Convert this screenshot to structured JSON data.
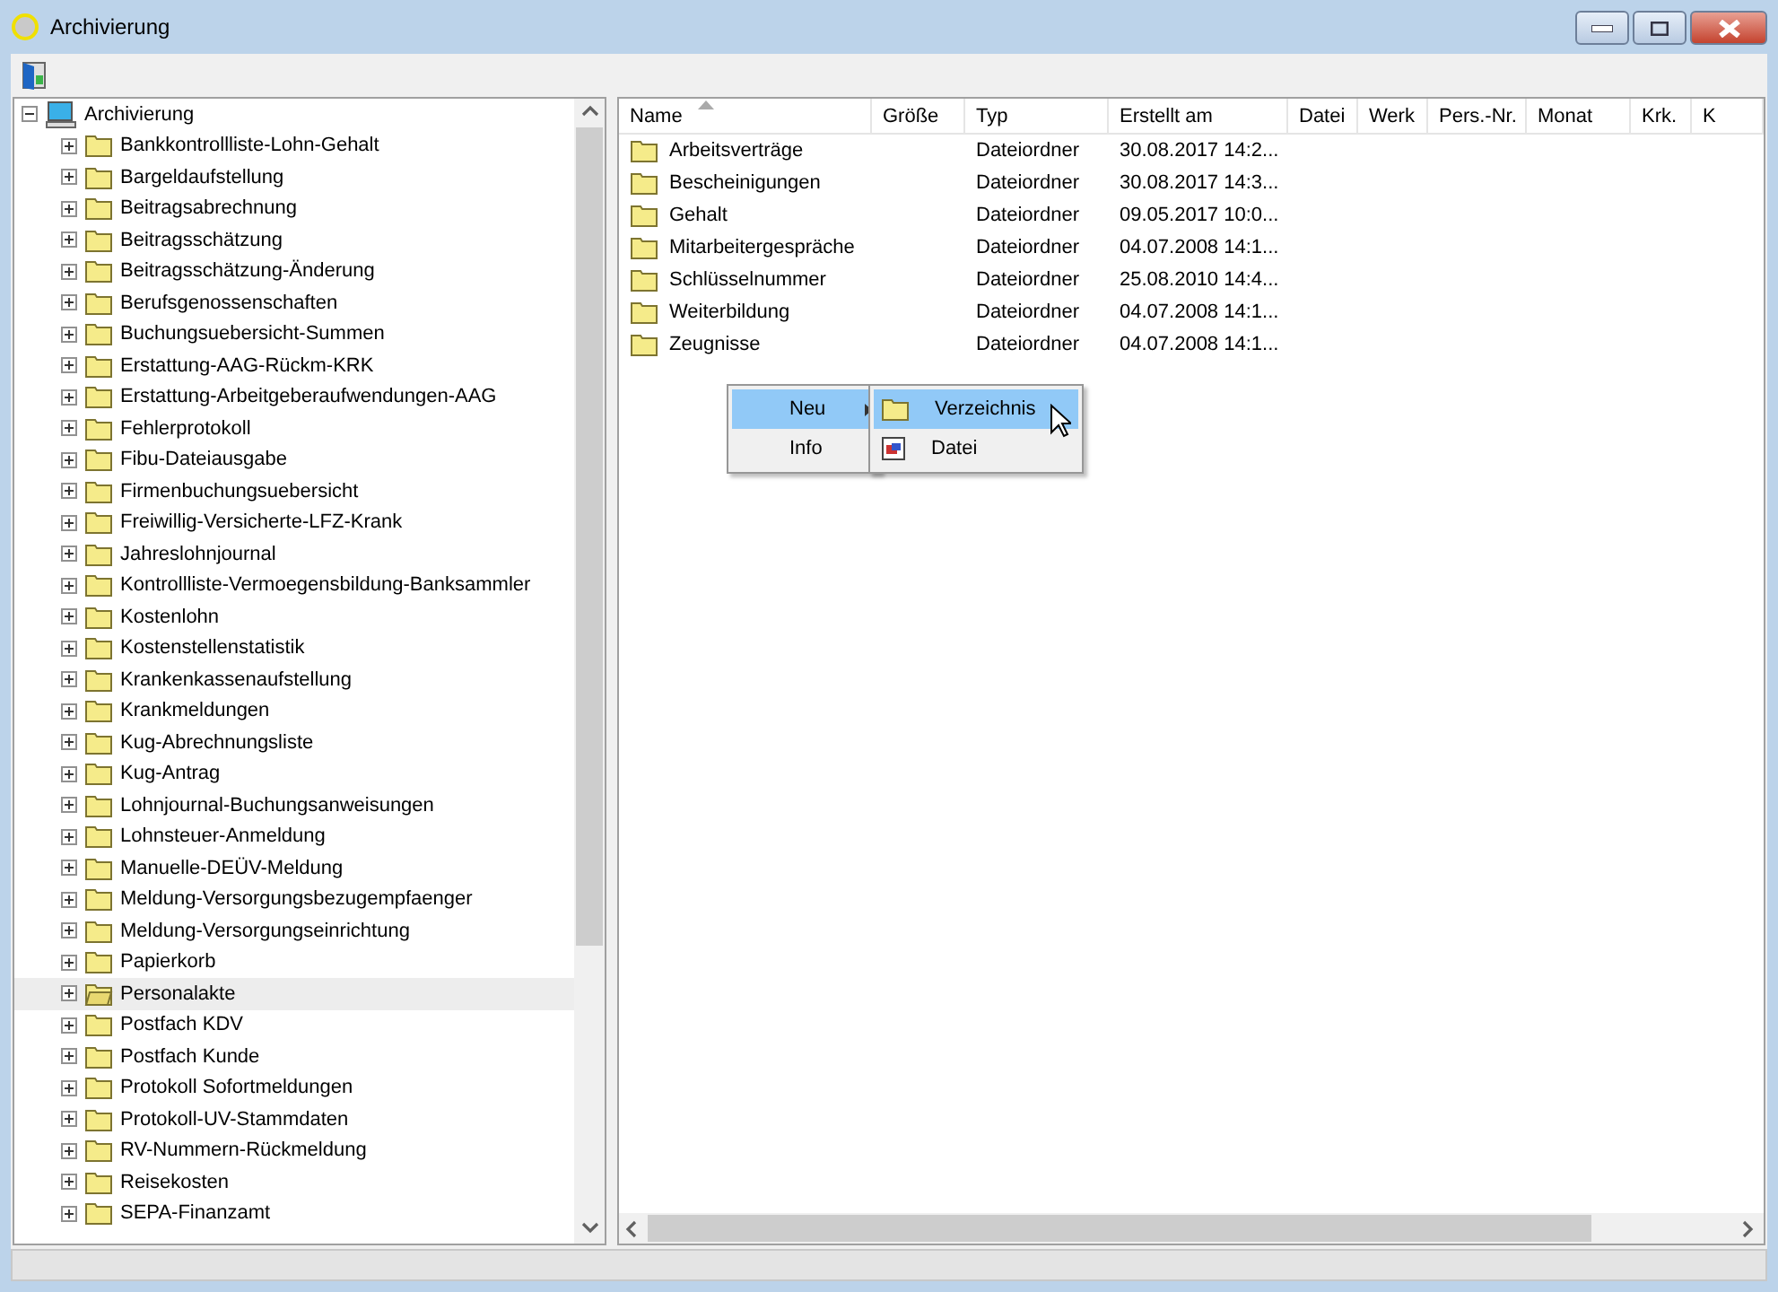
{
  "window": {
    "title": "Archivierung"
  },
  "tree": {
    "label": "Archivierung",
    "expanded": true,
    "children": [
      {
        "label": "Bankkontrollliste-Lohn-Gehalt",
        "expanded": false,
        "selected": false
      },
      {
        "label": "Bargeldaufstellung",
        "expanded": false,
        "selected": false
      },
      {
        "label": "Beitragsabrechnung",
        "expanded": false,
        "selected": false
      },
      {
        "label": "Beitragsschätzung",
        "expanded": false,
        "selected": false
      },
      {
        "label": "Beitragsschätzung-Änderung",
        "expanded": false,
        "selected": false
      },
      {
        "label": "Berufsgenossenschaften",
        "expanded": false,
        "selected": false
      },
      {
        "label": "Buchungsuebersicht-Summen",
        "expanded": false,
        "selected": false
      },
      {
        "label": "Erstattung-AAG-Rückm-KRK",
        "expanded": false,
        "selected": false
      },
      {
        "label": "Erstattung-Arbeitgeberaufwendungen-AAG",
        "expanded": false,
        "selected": false
      },
      {
        "label": "Fehlerprotokoll",
        "expanded": false,
        "selected": false
      },
      {
        "label": "Fibu-Dateiausgabe",
        "expanded": false,
        "selected": false
      },
      {
        "label": "Firmenbuchungsuebersicht",
        "expanded": false,
        "selected": false
      },
      {
        "label": "Freiwillig-Versicherte-LFZ-Krank",
        "expanded": false,
        "selected": false
      },
      {
        "label": "Jahreslohnjournal",
        "expanded": false,
        "selected": false
      },
      {
        "label": "Kontrollliste-Vermoegensbildung-Banksammler",
        "expanded": false,
        "selected": false
      },
      {
        "label": "Kostenlohn",
        "expanded": false,
        "selected": false
      },
      {
        "label": "Kostenstellenstatistik",
        "expanded": false,
        "selected": false
      },
      {
        "label": "Krankenkassenaufstellung",
        "expanded": false,
        "selected": false
      },
      {
        "label": "Krankmeldungen",
        "expanded": false,
        "selected": false
      },
      {
        "label": "Kug-Abrechnungsliste",
        "expanded": false,
        "selected": false
      },
      {
        "label": "Kug-Antrag",
        "expanded": false,
        "selected": false
      },
      {
        "label": "Lohnjournal-Buchungsanweisungen",
        "expanded": false,
        "selected": false
      },
      {
        "label": "Lohnsteuer-Anmeldung",
        "expanded": false,
        "selected": false
      },
      {
        "label": "Manuelle-DEÜV-Meldung",
        "expanded": false,
        "selected": false
      },
      {
        "label": "Meldung-Versorgungsbezugempfaenger",
        "expanded": false,
        "selected": false
      },
      {
        "label": "Meldung-Versorgungseinrichtung",
        "expanded": false,
        "selected": false
      },
      {
        "label": "Papierkorb",
        "expanded": false,
        "selected": false
      },
      {
        "label": "Personalakte",
        "expanded": false,
        "selected": true
      },
      {
        "label": "Postfach KDV",
        "expanded": false,
        "selected": false
      },
      {
        "label": "Postfach Kunde",
        "expanded": false,
        "selected": false
      },
      {
        "label": "Protokoll Sofortmeldungen",
        "expanded": false,
        "selected": false
      },
      {
        "label": "Protokoll-UV-Stammdaten",
        "expanded": false,
        "selected": false
      },
      {
        "label": "RV-Nummern-Rückmeldung",
        "expanded": false,
        "selected": false
      },
      {
        "label": "Reisekosten",
        "expanded": false,
        "selected": false
      },
      {
        "label": "SEPA-Finanzamt",
        "expanded": false,
        "selected": false
      }
    ]
  },
  "list": {
    "columns": [
      {
        "label": "Name",
        "sorted": true
      },
      {
        "label": "Größe",
        "sorted": false
      },
      {
        "label": "Typ",
        "sorted": false
      },
      {
        "label": "Erstellt am",
        "sorted": false
      },
      {
        "label": "Datei",
        "sorted": false
      },
      {
        "label": "Werk",
        "sorted": false
      },
      {
        "label": "Pers.-Nr.",
        "sorted": false
      },
      {
        "label": "Monat",
        "sorted": false
      },
      {
        "label": "Krk.",
        "sorted": false
      },
      {
        "label": "K",
        "sorted": false
      }
    ],
    "rows": [
      {
        "name": "Arbeitsverträge",
        "type": "Dateiordner",
        "created": "30.08.2017 14:2..."
      },
      {
        "name": "Bescheinigungen",
        "type": "Dateiordner",
        "created": "30.08.2017 14:3..."
      },
      {
        "name": "Gehalt",
        "type": "Dateiordner",
        "created": "09.05.2017 10:0..."
      },
      {
        "name": "Mitarbeitergespräche",
        "type": "Dateiordner",
        "created": "04.07.2008 14:1..."
      },
      {
        "name": "Schlüsselnummer",
        "type": "Dateiordner",
        "created": "25.08.2010 14:4..."
      },
      {
        "name": "Weiterbildung",
        "type": "Dateiordner",
        "created": "04.07.2008 14:1..."
      },
      {
        "name": "Zeugnisse",
        "type": "Dateiordner",
        "created": "04.07.2008 14:1..."
      }
    ]
  },
  "context_menu": {
    "items": [
      {
        "label": "Neu",
        "selected": true,
        "has_submenu": true
      },
      {
        "label": "Info",
        "selected": false,
        "has_submenu": false
      }
    ]
  },
  "submenu": {
    "items": [
      {
        "label": "Verzeichnis",
        "kind": "folder",
        "selected": true
      },
      {
        "label": "Datei",
        "kind": "file",
        "selected": false
      }
    ]
  }
}
